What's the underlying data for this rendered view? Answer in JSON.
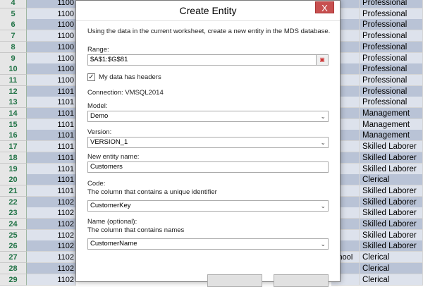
{
  "sheet": {
    "rows": [
      {
        "num": "4",
        "id": "1100",
        "edu": "",
        "occ": "Professional"
      },
      {
        "num": "5",
        "id": "1100",
        "edu": "",
        "occ": "Professional"
      },
      {
        "num": "6",
        "id": "1100",
        "edu": "",
        "occ": "Professional"
      },
      {
        "num": "7",
        "id": "1100",
        "edu": "",
        "occ": "Professional"
      },
      {
        "num": "8",
        "id": "1100",
        "edu": "",
        "occ": "Professional"
      },
      {
        "num": "9",
        "id": "1100",
        "edu": "",
        "occ": "Professional"
      },
      {
        "num": "10",
        "id": "1100",
        "edu": "",
        "occ": "Professional"
      },
      {
        "num": "11",
        "id": "1100",
        "edu": "",
        "occ": "Professional"
      },
      {
        "num": "12",
        "id": "1101",
        "edu": "",
        "occ": "Professional"
      },
      {
        "num": "13",
        "id": "1101",
        "edu": "",
        "occ": "Professional"
      },
      {
        "num": "14",
        "id": "1101",
        "edu": "",
        "occ": "Management"
      },
      {
        "num": "15",
        "id": "1101",
        "edu": "",
        "occ": "Management"
      },
      {
        "num": "16",
        "id": "1101",
        "edu": "",
        "occ": "Management"
      },
      {
        "num": "17",
        "id": "1101",
        "edu": "e",
        "occ": "Skilled Laborer"
      },
      {
        "num": "18",
        "id": "1101",
        "edu": "e",
        "occ": "Skilled Laborer"
      },
      {
        "num": "19",
        "id": "1101",
        "edu": "",
        "occ": "Skilled Laborer"
      },
      {
        "num": "20",
        "id": "1101",
        "edu": "e",
        "occ": "Clerical"
      },
      {
        "num": "21",
        "id": "1101",
        "edu": "",
        "occ": "Skilled Laborer"
      },
      {
        "num": "22",
        "id": "1102",
        "edu": "",
        "occ": "Skilled Laborer"
      },
      {
        "num": "23",
        "id": "1102",
        "edu": "",
        "occ": "Skilled Laborer"
      },
      {
        "num": "24",
        "id": "1102",
        "edu": "e",
        "occ": "Skilled Laborer"
      },
      {
        "num": "25",
        "id": "1102",
        "edu": "e",
        "occ": "Skilled Laborer"
      },
      {
        "num": "26",
        "id": "1102",
        "edu": "e",
        "occ": "Skilled Laborer"
      },
      {
        "num": "27",
        "id": "1102",
        "edu": "chool",
        "occ": "Clerical"
      },
      {
        "num": "28",
        "id": "1102",
        "edu": "",
        "occ": "Clerical"
      },
      {
        "num": "29",
        "id": "1102",
        "edu": "",
        "occ": "Clerical"
      }
    ]
  },
  "dialog": {
    "title": "Create Entity",
    "close_label": "X",
    "intro": "Using the data in the current worksheet, create a new entity in the MDS database.",
    "range_label": "Range:",
    "range_value": "$A$1:$G$81",
    "headers_label": "My data has headers",
    "headers_checked": true,
    "connection": "Connection: VMSQL2014",
    "model_label": "Model:",
    "model_value": "Demo",
    "version_label": "Version:",
    "version_value": "VERSION_1",
    "entity_label": "New entity name:",
    "entity_value": "Customers",
    "code_label": "Code:",
    "code_desc": "The column that contains a unique identifier",
    "code_value": "CustomerKey",
    "name_label": "Name (optional):",
    "name_desc": "The column that contains names",
    "name_value": "CustomerName"
  },
  "colors": {
    "row_header_text": "#217346",
    "band_dark": "#b9c3d6",
    "band_light": "#dde2ec",
    "close_button": "#c75050"
  },
  "icons": {
    "range_picker": "range-select-icon",
    "dropdown": "chevron-down-icon",
    "checkbox": "checkmark-icon"
  }
}
